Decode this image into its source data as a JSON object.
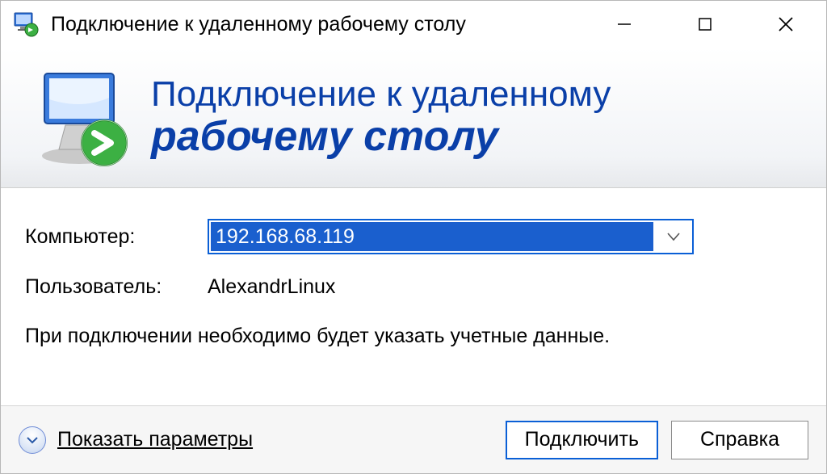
{
  "titlebar": {
    "title": "Подключение к удаленному рабочему столу"
  },
  "header": {
    "line1": "Подключение к удаленному",
    "line2": "рабочему столу"
  },
  "form": {
    "computer_label": "Компьютер:",
    "computer_value": "192.168.68.119",
    "user_label": "Пользователь:",
    "user_value": "AlexandrLinux",
    "hint": "При подключении необходимо будет указать учетные данные."
  },
  "footer": {
    "show_options_label": "Показать параметры",
    "connect_label": "Подключить",
    "help_label": "Справка"
  }
}
